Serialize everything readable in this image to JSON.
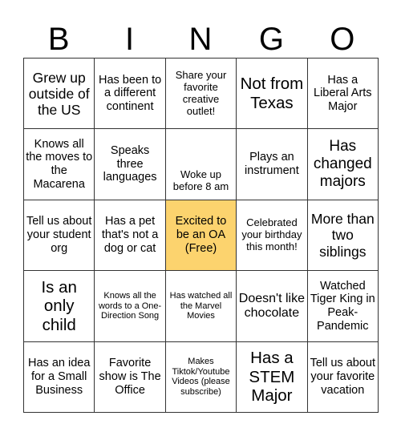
{
  "title_letters": [
    "B",
    "I",
    "N",
    "G",
    "O"
  ],
  "colors": {
    "free_cell": "#fcd36e",
    "grid_line": "#333333"
  },
  "cells": [
    [
      "Grew up outside of the US",
      "Has been to a different continent",
      "Share your favorite creative outlet!",
      "Not from Texas",
      "Has a Liberal Arts Major"
    ],
    [
      "Knows all the moves to the Macarena",
      "Speaks three languages",
      "Woke up before 8 am",
      "Plays an instrument",
      "Has changed majors"
    ],
    [
      "Tell us about your student org",
      "Has a pet that's not a dog or cat",
      "Excited to be an OA (Free)",
      "Celebrated your birthday this month!",
      "More than two siblings"
    ],
    [
      "Is an only child",
      "Knows all the words to a One-Direction Song",
      "Has watched all the Marvel Movies",
      "Doesn't like chocolate",
      "Watched Tiger King in Peak-Pandemic"
    ],
    [
      "Has an idea for a Small Business",
      "Favorite show is The Office",
      "Makes Tiktok/Youtube Videos (please subscribe)",
      "Has a STEM Major",
      "Tell us about your favorite vacation"
    ]
  ],
  "free_cell": {
    "row": 2,
    "col": 2,
    "label": "Free"
  }
}
